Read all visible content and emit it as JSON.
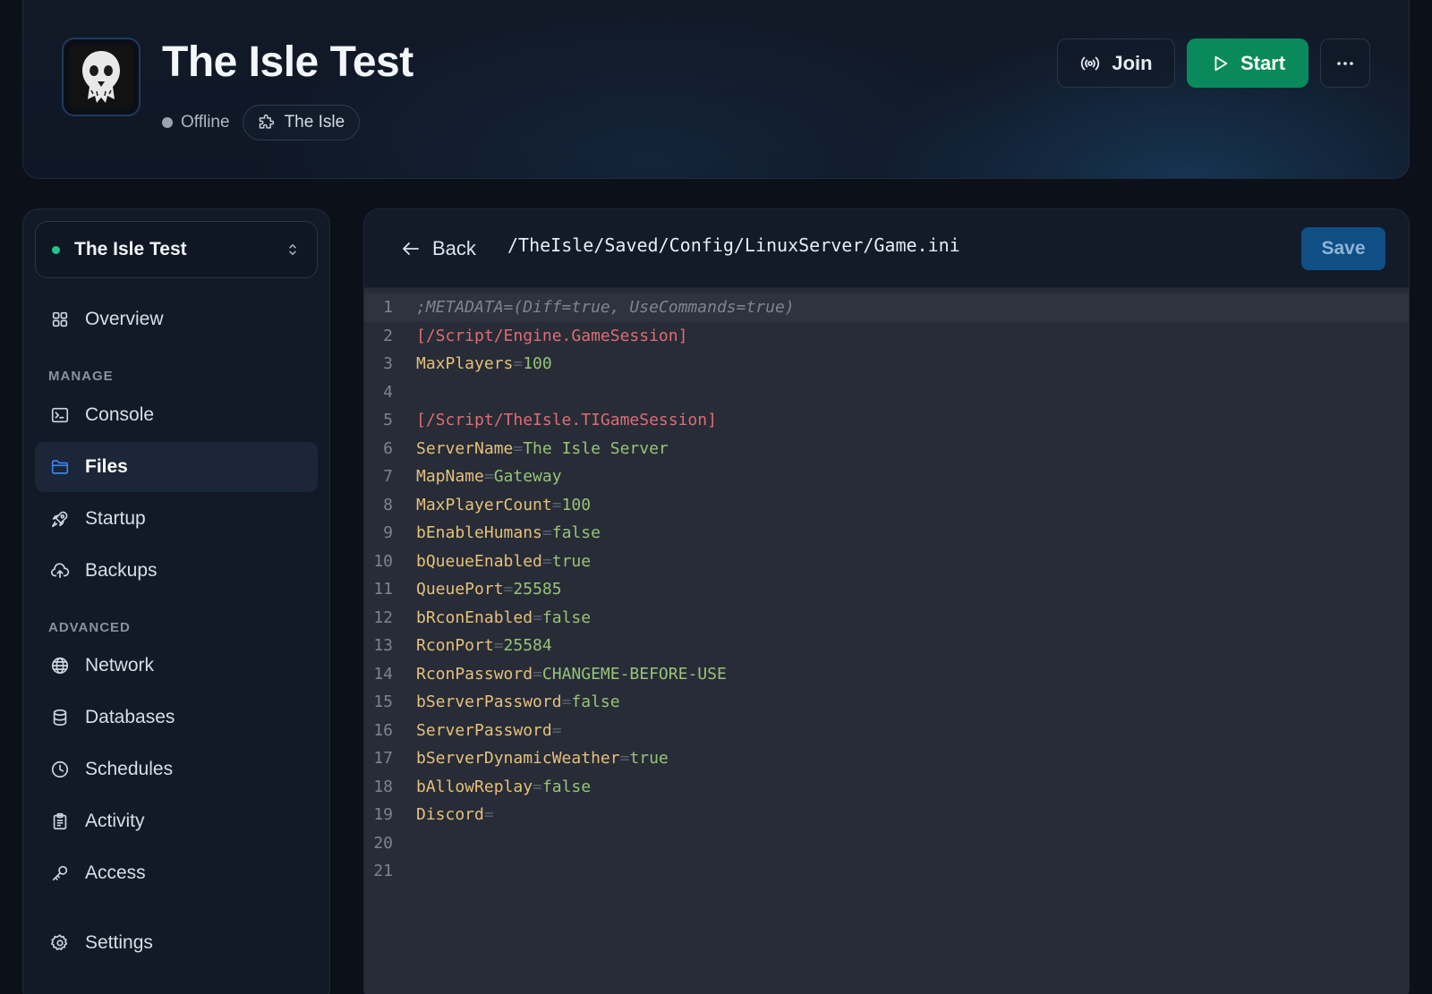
{
  "header": {
    "title": "The Isle Test",
    "status": "Offline",
    "egg": "The Isle",
    "join_label": "Join",
    "start_label": "Start"
  },
  "sidebar": {
    "server_select": "The Isle Test",
    "overview": "Overview",
    "section_manage": "MANAGE",
    "console": "Console",
    "files": "Files",
    "startup": "Startup",
    "backups": "Backups",
    "section_advanced": "ADVANCED",
    "network": "Network",
    "databases": "Databases",
    "schedules": "Schedules",
    "activity": "Activity",
    "access": "Access",
    "settings": "Settings",
    "active_item": "Files"
  },
  "editor": {
    "back_label": "Back",
    "path": "/TheIsle/Saved/Config/LinuxServer/Game.ini",
    "save_label": "Save",
    "lines": [
      ";METADATA=(Diff=true, UseCommands=true)",
      "[/Script/Engine.GameSession]",
      "MaxPlayers=100",
      "",
      "[/Script/TheIsle.TIGameSession]",
      "ServerName=The Isle Server",
      "MapName=Gateway",
      "MaxPlayerCount=100",
      "bEnableHumans=false",
      "bQueueEnabled=true",
      "QueuePort=25585",
      "bRconEnabled=false",
      "RconPort=25584",
      "RconPassword=CHANGEME-BEFORE-USE",
      "bServerPassword=false",
      "ServerPassword=",
      "bServerDynamicWeather=true",
      "bAllowReplay=false",
      "Discord=",
      "",
      ""
    ]
  },
  "colors": {
    "start": "#0a8a5c",
    "save": "#0f4f86",
    "online_dot": "#22c38a",
    "active_nav": "#1b2638",
    "files_icon": "#3b82f6"
  }
}
